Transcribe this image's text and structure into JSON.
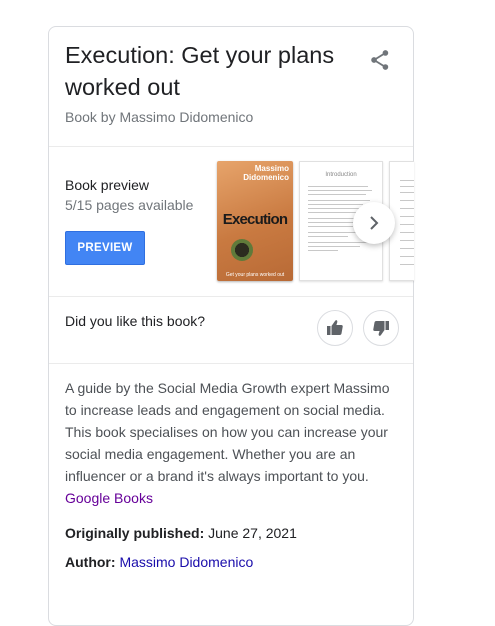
{
  "header": {
    "title": "Execution: Get your plans worked out",
    "subtitle": "Book by Massimo Didomenico"
  },
  "preview": {
    "label": "Book preview",
    "pages": "5/15 pages available",
    "button_label": "PREVIEW",
    "cover": {
      "author": "Massimo Didomenico",
      "title": "Execution",
      "subtitle": "Get your plans worked out"
    },
    "page_heading": "Introduction"
  },
  "feedback": {
    "question": "Did you like this book?"
  },
  "description": {
    "text": "A guide by the Social Media Growth expert Massimo to increase leads and engagement on social media. This book specialises on how you can increase your social media engagement. Whether you are an influencer or a brand it's always important to you.",
    "source_link": "Google Books"
  },
  "facts": {
    "published_label": "Originally published:",
    "published_value": "June 27, 2021",
    "author_label": "Author:",
    "author_value": "Massimo Didomenico"
  },
  "icons": {
    "share": "share-icon",
    "next": "chevron-right-icon",
    "like": "thumbs-up-icon",
    "dislike": "thumbs-down-icon"
  },
  "colors": {
    "preview_button": "#4285f4",
    "visited_link": "#660099",
    "link": "#1a0dab",
    "muted_text": "#70757a"
  }
}
